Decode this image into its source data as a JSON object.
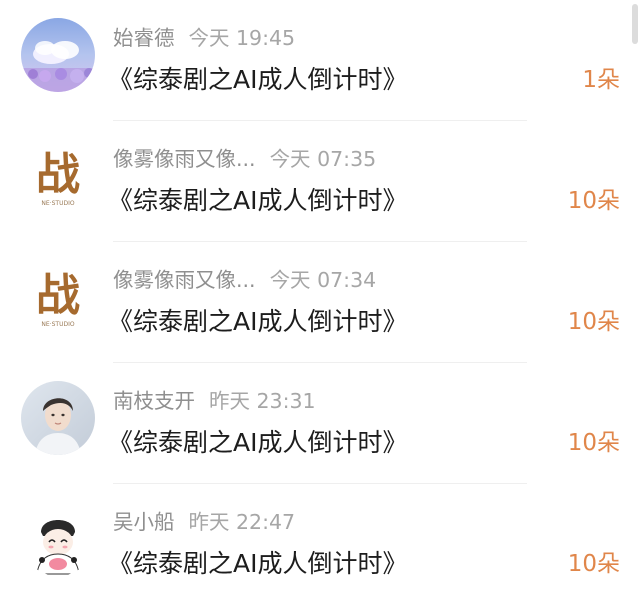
{
  "gifts": [
    {
      "user": "始睿德",
      "time": "今天 19:45",
      "title": "《综泰剧之AI成人倒计时》",
      "count": "1朵",
      "avatar_icon": "cloud-sky-avatar"
    },
    {
      "user": "像雾像雨又像...",
      "time": "今天 07:35",
      "title": "《综泰剧之AI成人倒计时》",
      "count": "10朵",
      "avatar_icon": "calligraphy-zhan-avatar",
      "avatar_text": "战",
      "avatar_subtext": "NE·STUDIO"
    },
    {
      "user": "像雾像雨又像...",
      "time": "今天 07:34",
      "title": "《综泰剧之AI成人倒计时》",
      "count": "10朵",
      "avatar_icon": "calligraphy-zhan-avatar",
      "avatar_text": "战",
      "avatar_subtext": "NE·STUDIO"
    },
    {
      "user": "南枝支开",
      "time": "昨天 23:31",
      "title": "《综泰剧之AI成人倒计时》",
      "count": "10朵",
      "avatar_icon": "person-portrait-avatar"
    },
    {
      "user": "吴小船",
      "time": "昨天 22:47",
      "title": "《综泰剧之AI成人倒计时》",
      "count": "10朵",
      "avatar_icon": "cartoon-character-avatar"
    }
  ],
  "colors": {
    "accent": "#e0864a",
    "username": "#8f8f8f",
    "timestamp": "#a6a6a6",
    "title": "#1d1d1d",
    "divider": "#efefef",
    "calligraphy": "#a66a2e"
  }
}
